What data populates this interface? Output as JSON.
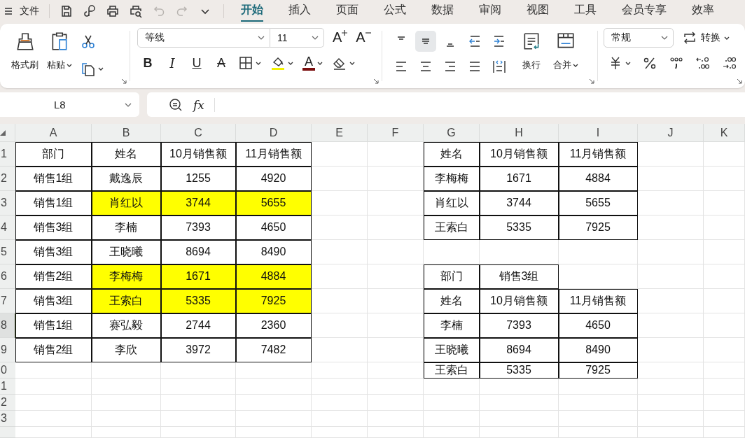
{
  "menu": {
    "file": "文件"
  },
  "quick_access": [
    {
      "kind": "save",
      "disabled": false
    },
    {
      "kind": "loop",
      "disabled": false
    },
    {
      "kind": "print",
      "disabled": false
    },
    {
      "kind": "preview",
      "disabled": false
    },
    {
      "kind": "undo",
      "disabled": true
    },
    {
      "kind": "redo",
      "disabled": true
    },
    {
      "kind": "more",
      "disabled": false
    }
  ],
  "tabs": [
    {
      "label": "开始",
      "selected": true
    },
    {
      "label": "插入",
      "selected": false
    },
    {
      "label": "页面",
      "selected": false
    },
    {
      "label": "公式",
      "selected": false
    },
    {
      "label": "数据",
      "selected": false
    },
    {
      "label": "审阅",
      "selected": false
    },
    {
      "label": "视图",
      "selected": false
    },
    {
      "label": "工具",
      "selected": false
    },
    {
      "label": "会员专享",
      "selected": false
    },
    {
      "label": "效率",
      "selected": false
    }
  ],
  "ribbon": {
    "format_painter": "格式刷",
    "paste": "粘贴",
    "font_name": "等线",
    "font_size": "11",
    "grow_font": "A",
    "shrink_font": "A",
    "style_buttons": [
      {
        "label": "B",
        "kind": "bold"
      },
      {
        "label": "I",
        "kind": "italic"
      },
      {
        "label": "U",
        "kind": "underline"
      },
      {
        "label": "A",
        "kind": "strike"
      }
    ],
    "font_color": "A",
    "align_buttons": [
      {
        "kind": "top",
        "selected": false
      },
      {
        "kind": "middle",
        "selected": true
      },
      {
        "kind": "bottom",
        "selected": false
      },
      {
        "kind": "outdent",
        "selected": false
      },
      {
        "kind": "indent",
        "selected": false
      },
      {
        "kind": "left",
        "selected": false
      },
      {
        "kind": "center",
        "selected": false
      },
      {
        "kind": "right",
        "selected": false
      },
      {
        "kind": "justify",
        "selected": false
      },
      {
        "kind": "distributed",
        "selected": false
      }
    ],
    "wrap": "换行",
    "merge": "合并",
    "number_format": "常规",
    "convert": "转换"
  },
  "formula_bar": {
    "name_box": "L8",
    "fx": "fx"
  },
  "sheet": {
    "columns": [
      "A",
      "B",
      "C",
      "D",
      "E",
      "F",
      "G",
      "H",
      "I",
      "J",
      "K"
    ],
    "rows": [
      {
        "number": "1",
        "selected": false,
        "cells": [
          {
            "text": "部门",
            "bordered": true,
            "highlighted": false
          },
          {
            "text": "姓名",
            "bordered": true,
            "highlighted": false
          },
          {
            "text": "10月销售额",
            "bordered": true,
            "highlighted": false
          },
          {
            "text": "11月销售额",
            "bordered": true,
            "highlighted": false
          },
          {
            "bordered": false,
            "highlighted": false
          },
          {
            "bordered": false,
            "highlighted": false
          },
          {
            "text": "姓名",
            "bordered": true,
            "highlighted": false
          },
          {
            "text": "10月销售额",
            "bordered": true,
            "highlighted": false
          },
          {
            "text": "11月销售额",
            "bordered": true,
            "highlighted": false
          },
          {
            "bordered": false,
            "highlighted": false
          },
          {
            "bordered": false,
            "highlighted": false
          }
        ]
      },
      {
        "number": "2",
        "selected": false,
        "cells": [
          {
            "text": "销售1组",
            "bordered": true,
            "highlighted": false
          },
          {
            "text": "戴逸辰",
            "bordered": true,
            "highlighted": false
          },
          {
            "text": "1255",
            "bordered": true,
            "highlighted": false
          },
          {
            "text": "4920",
            "bordered": true,
            "highlighted": false
          },
          {
            "bordered": false,
            "highlighted": false
          },
          {
            "bordered": false,
            "highlighted": false
          },
          {
            "text": "李梅梅",
            "bordered": true,
            "highlighted": false
          },
          {
            "text": "1671",
            "bordered": true,
            "highlighted": false
          },
          {
            "text": "4884",
            "bordered": true,
            "highlighted": false
          },
          {
            "bordered": false,
            "highlighted": false
          },
          {
            "bordered": false,
            "highlighted": false
          }
        ]
      },
      {
        "number": "3",
        "selected": false,
        "cells": [
          {
            "text": "销售1组",
            "bordered": true,
            "highlighted": false
          },
          {
            "text": "肖红以",
            "bordered": true,
            "highlighted": true
          },
          {
            "text": "3744",
            "bordered": true,
            "highlighted": true
          },
          {
            "text": "5655",
            "bordered": true,
            "highlighted": true
          },
          {
            "bordered": false,
            "highlighted": false
          },
          {
            "bordered": false,
            "highlighted": false
          },
          {
            "text": "肖红以",
            "bordered": true,
            "highlighted": false
          },
          {
            "text": "3744",
            "bordered": true,
            "highlighted": false
          },
          {
            "text": "5655",
            "bordered": true,
            "highlighted": false
          },
          {
            "bordered": false,
            "highlighted": false
          },
          {
            "bordered": false,
            "highlighted": false
          }
        ]
      },
      {
        "number": "4",
        "selected": false,
        "cells": [
          {
            "text": "销售3组",
            "bordered": true,
            "highlighted": false
          },
          {
            "text": "李楠",
            "bordered": true,
            "highlighted": false
          },
          {
            "text": "7393",
            "bordered": true,
            "highlighted": false
          },
          {
            "text": "4650",
            "bordered": true,
            "highlighted": false
          },
          {
            "bordered": false,
            "highlighted": false
          },
          {
            "bordered": false,
            "highlighted": false
          },
          {
            "text": "王索白",
            "bordered": true,
            "highlighted": false
          },
          {
            "text": "5335",
            "bordered": true,
            "highlighted": false
          },
          {
            "text": "7925",
            "bordered": true,
            "highlighted": false
          },
          {
            "bordered": false,
            "highlighted": false
          },
          {
            "bordered": false,
            "highlighted": false
          }
        ]
      },
      {
        "number": "5",
        "selected": false,
        "cells": [
          {
            "text": "销售3组",
            "bordered": true,
            "highlighted": false
          },
          {
            "text": "王晓曦",
            "bordered": true,
            "highlighted": false
          },
          {
            "text": "8694",
            "bordered": true,
            "highlighted": false
          },
          {
            "text": "8490",
            "bordered": true,
            "highlighted": false
          },
          {
            "bordered": false,
            "highlighted": false
          },
          {
            "bordered": false,
            "highlighted": false
          },
          {
            "bordered": false,
            "highlighted": false
          },
          {
            "bordered": false,
            "highlighted": false
          },
          {
            "bordered": false,
            "highlighted": false
          },
          {
            "bordered": false,
            "highlighted": false
          },
          {
            "bordered": false,
            "highlighted": false
          }
        ]
      },
      {
        "number": "6",
        "selected": false,
        "cells": [
          {
            "text": "销售2组",
            "bordered": true,
            "highlighted": false
          },
          {
            "text": "李梅梅",
            "bordered": true,
            "highlighted": true
          },
          {
            "text": "1671",
            "bordered": true,
            "highlighted": true
          },
          {
            "text": "4884",
            "bordered": true,
            "highlighted": true
          },
          {
            "bordered": false,
            "highlighted": false
          },
          {
            "bordered": false,
            "highlighted": false
          },
          {
            "text": "部门",
            "bordered": true,
            "highlighted": false
          },
          {
            "text": "销售3组",
            "bordered": true,
            "highlighted": false
          },
          {
            "bordered": false,
            "highlighted": false
          },
          {
            "bordered": false,
            "highlighted": false
          },
          {
            "bordered": false,
            "highlighted": false
          }
        ]
      },
      {
        "number": "7",
        "selected": false,
        "cells": [
          {
            "text": "销售3组",
            "bordered": true,
            "highlighted": false
          },
          {
            "text": "王索白",
            "bordered": true,
            "highlighted": true
          },
          {
            "text": "5335",
            "bordered": true,
            "highlighted": true
          },
          {
            "text": "7925",
            "bordered": true,
            "highlighted": true
          },
          {
            "bordered": false,
            "highlighted": false
          },
          {
            "bordered": false,
            "highlighted": false
          },
          {
            "text": "姓名",
            "bordered": true,
            "highlighted": false
          },
          {
            "text": "10月销售额",
            "bordered": true,
            "highlighted": false
          },
          {
            "text": "11月销售额",
            "bordered": true,
            "highlighted": false
          },
          {
            "bordered": false,
            "highlighted": false
          },
          {
            "bordered": false,
            "highlighted": false
          }
        ]
      },
      {
        "number": "8",
        "selected": true,
        "cells": [
          {
            "text": "销售1组",
            "bordered": true,
            "highlighted": false
          },
          {
            "text": "赛弘毅",
            "bordered": true,
            "highlighted": false
          },
          {
            "text": "2744",
            "bordered": true,
            "highlighted": false
          },
          {
            "text": "2360",
            "bordered": true,
            "highlighted": false
          },
          {
            "bordered": false,
            "highlighted": false
          },
          {
            "bordered": false,
            "highlighted": false
          },
          {
            "text": "李楠",
            "bordered": true,
            "highlighted": false
          },
          {
            "text": "7393",
            "bordered": true,
            "highlighted": false
          },
          {
            "text": "4650",
            "bordered": true,
            "highlighted": false
          },
          {
            "bordered": false,
            "highlighted": false
          },
          {
            "bordered": false,
            "highlighted": false
          }
        ]
      },
      {
        "number": "9",
        "selected": false,
        "cells": [
          {
            "text": "销售2组",
            "bordered": true,
            "highlighted": false
          },
          {
            "text": "李欣",
            "bordered": true,
            "highlighted": false
          },
          {
            "text": "3972",
            "bordered": true,
            "highlighted": false
          },
          {
            "text": "7482",
            "bordered": true,
            "highlighted": false
          },
          {
            "bordered": false,
            "highlighted": false
          },
          {
            "bordered": false,
            "highlighted": false
          },
          {
            "text": "王晓曦",
            "bordered": true,
            "highlighted": false
          },
          {
            "text": "8694",
            "bordered": true,
            "highlighted": false
          },
          {
            "text": "8490",
            "bordered": true,
            "highlighted": false
          },
          {
            "bordered": false,
            "highlighted": false
          },
          {
            "bordered": false,
            "highlighted": false
          }
        ]
      },
      {
        "number": "0",
        "selected": false,
        "cells": [
          {
            "bordered": false,
            "highlighted": false
          },
          {
            "bordered": false,
            "highlighted": false
          },
          {
            "bordered": false,
            "highlighted": false
          },
          {
            "bordered": false,
            "highlighted": false
          },
          {
            "bordered": false,
            "highlighted": false
          },
          {
            "bordered": false,
            "highlighted": false
          },
          {
            "text": "王索白",
            "bordered": true,
            "highlighted": false
          },
          {
            "text": "5335",
            "bordered": true,
            "highlighted": false
          },
          {
            "text": "7925",
            "bordered": true,
            "highlighted": false
          },
          {
            "bordered": false,
            "highlighted": false
          },
          {
            "bordered": false,
            "highlighted": false
          }
        ]
      },
      {
        "number": "1",
        "selected": false
      },
      {
        "number": "2",
        "selected": false
      },
      {
        "number": "3",
        "selected": false
      },
      {
        "selected": false
      }
    ]
  }
}
